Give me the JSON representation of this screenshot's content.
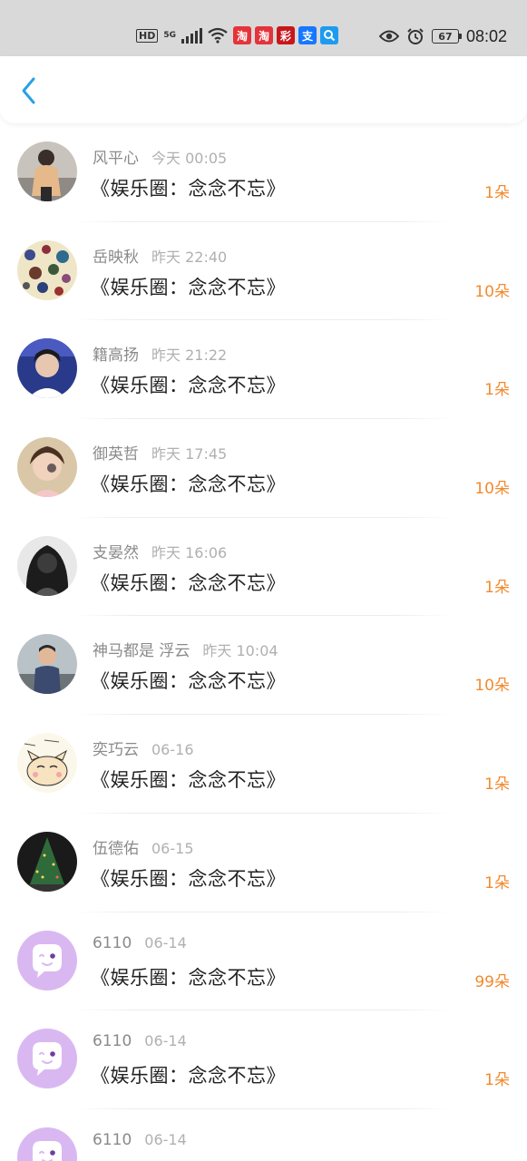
{
  "status_bar": {
    "hd": "HD",
    "network": "5G",
    "apps": [
      {
        "name": "taobao-icon",
        "glyph": "淘",
        "color": "#e5333a"
      },
      {
        "name": "taobao-icon",
        "glyph": "淘",
        "color": "#e5333a"
      },
      {
        "name": "lottery-icon",
        "glyph": "彩",
        "color": "#c8161d"
      },
      {
        "name": "alipay-icon",
        "glyph": "支",
        "color": "#1677ff"
      },
      {
        "name": "search-app-icon",
        "glyph": "",
        "color": "#1e9bf0"
      }
    ],
    "battery": "67",
    "time": "08:02"
  },
  "header": {
    "back_icon": "chevron-left-icon",
    "accent": "#2aa0e6"
  },
  "items": [
    {
      "name": "风平心",
      "time": "今天 00:05",
      "title": "《娱乐圈：念念不忘》",
      "flowers": "1朵"
    },
    {
      "name": "岳映秋",
      "time": "昨天 22:40",
      "title": "《娱乐圈：念念不忘》",
      "flowers": "10朵"
    },
    {
      "name": "籍高扬",
      "time": "昨天 21:22",
      "title": "《娱乐圈：念念不忘》",
      "flowers": "1朵"
    },
    {
      "name": "御英哲",
      "time": "昨天 17:45",
      "title": "《娱乐圈：念念不忘》",
      "flowers": "10朵"
    },
    {
      "name": "支晏然",
      "time": "昨天 16:06",
      "title": "《娱乐圈：念念不忘》",
      "flowers": "1朵"
    },
    {
      "name": "神马都是 浮云",
      "time": "昨天 10:04",
      "title": "《娱乐圈：念念不忘》",
      "flowers": "10朵"
    },
    {
      "name": "奕巧云",
      "time": "06-16",
      "title": "《娱乐圈：念念不忘》",
      "flowers": "1朵"
    },
    {
      "name": "伍德佑",
      "time": "06-15",
      "title": "《娱乐圈：念念不忘》",
      "flowers": "1朵"
    },
    {
      "name": "6110",
      "time": "06-14",
      "title": "《娱乐圈：念念不忘》",
      "flowers": "99朵"
    },
    {
      "name": "6110",
      "time": "06-14",
      "title": "《娱乐圈：念念不忘》",
      "flowers": "1朵"
    },
    {
      "name": "6110",
      "time": "06-14",
      "title": "",
      "flowers": ""
    }
  ],
  "colors": {
    "flower": "#f28a2e",
    "default_avatar": "#d9b8f2"
  }
}
